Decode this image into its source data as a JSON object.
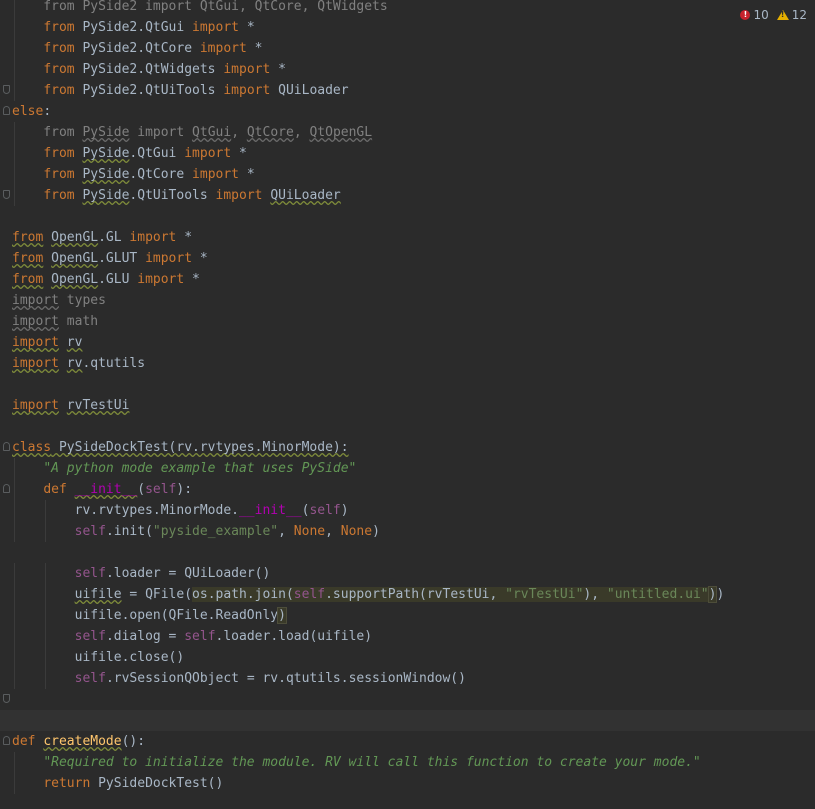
{
  "inspection": {
    "errors": "10",
    "warnings": "12"
  },
  "colors": {
    "background": "#2b2b2b",
    "keyword": "#cc7832",
    "string": "#6a8759",
    "self": "#94558d",
    "function_name": "#ffc66d",
    "error": "#c7222d",
    "warning": "#e6b000"
  },
  "code_lines": [
    [
      {
        "t": "    from PySide2 import QtGui, QtCore, QtWidgets",
        "c": "gray"
      }
    ],
    [
      {
        "t": "    "
      },
      {
        "t": "from",
        "c": "kw"
      },
      {
        "t": " PySide2.QtGui "
      },
      {
        "t": "import",
        "c": "kw"
      },
      {
        "t": " *"
      }
    ],
    [
      {
        "t": "    "
      },
      {
        "t": "from",
        "c": "kw"
      },
      {
        "t": " PySide2.QtCore "
      },
      {
        "t": "import",
        "c": "kw"
      },
      {
        "t": " *"
      }
    ],
    [
      {
        "t": "    "
      },
      {
        "t": "from",
        "c": "kw"
      },
      {
        "t": " PySide2.QtWidgets "
      },
      {
        "t": "import",
        "c": "kw"
      },
      {
        "t": " *"
      }
    ],
    [
      {
        "t": "    "
      },
      {
        "t": "from",
        "c": "kw"
      },
      {
        "t": " PySide2.QtUiTools "
      },
      {
        "t": "import",
        "c": "kw"
      },
      {
        "t": " QUiLoader"
      }
    ],
    [
      {
        "t": "else",
        "c": "kw"
      },
      {
        "t": ":"
      }
    ],
    [
      {
        "t": "    from ",
        "c": "gray"
      },
      {
        "t": "PySide",
        "c": "gray ulg"
      },
      {
        "t": " import ",
        "c": "gray"
      },
      {
        "t": "QtGui",
        "c": "gray ulg"
      },
      {
        "t": ", ",
        "c": "gray"
      },
      {
        "t": "QtCore",
        "c": "gray ulg"
      },
      {
        "t": ", ",
        "c": "gray"
      },
      {
        "t": "QtOpenGL",
        "c": "gray ulg"
      }
    ],
    [
      {
        "t": "    "
      },
      {
        "t": "from",
        "c": "kw"
      },
      {
        "t": " "
      },
      {
        "t": "PySide",
        "c": "ul"
      },
      {
        "t": ".QtGui "
      },
      {
        "t": "import",
        "c": "kw"
      },
      {
        "t": " *"
      }
    ],
    [
      {
        "t": "    "
      },
      {
        "t": "from",
        "c": "kw"
      },
      {
        "t": " "
      },
      {
        "t": "PySide",
        "c": "ul"
      },
      {
        "t": ".QtCore "
      },
      {
        "t": "import",
        "c": "kw"
      },
      {
        "t": " *"
      }
    ],
    [
      {
        "t": "    "
      },
      {
        "t": "from",
        "c": "kw"
      },
      {
        "t": " "
      },
      {
        "t": "PySide",
        "c": "ul"
      },
      {
        "t": ".QtUiTools "
      },
      {
        "t": "import",
        "c": "kw"
      },
      {
        "t": " "
      },
      {
        "t": "QUiLoader",
        "c": "ul"
      }
    ],
    [],
    [
      {
        "t": "from",
        "c": "kw ul"
      },
      {
        "t": " "
      },
      {
        "t": "OpenGL",
        "c": "ul"
      },
      {
        "t": ".GL "
      },
      {
        "t": "import",
        "c": "kw"
      },
      {
        "t": " *"
      }
    ],
    [
      {
        "t": "from",
        "c": "kw ul"
      },
      {
        "t": " "
      },
      {
        "t": "OpenGL",
        "c": "ul"
      },
      {
        "t": ".GLUT "
      },
      {
        "t": "import",
        "c": "kw"
      },
      {
        "t": " *"
      }
    ],
    [
      {
        "t": "from",
        "c": "kw ul"
      },
      {
        "t": " "
      },
      {
        "t": "OpenGL",
        "c": "ul"
      },
      {
        "t": ".GLU "
      },
      {
        "t": "import",
        "c": "kw"
      },
      {
        "t": " *"
      }
    ],
    [
      {
        "t": "import",
        "c": "gray ulg"
      },
      {
        "t": " types",
        "c": "gray"
      }
    ],
    [
      {
        "t": "import",
        "c": "gray ulg"
      },
      {
        "t": " math",
        "c": "gray"
      }
    ],
    [
      {
        "t": "import",
        "c": "kw ul"
      },
      {
        "t": " "
      },
      {
        "t": "rv",
        "c": "ul"
      }
    ],
    [
      {
        "t": "import",
        "c": "kw ul"
      },
      {
        "t": " "
      },
      {
        "t": "rv",
        "c": "ul"
      },
      {
        "t": ".qtutils"
      }
    ],
    [],
    [
      {
        "t": "import",
        "c": "kw ul"
      },
      {
        "t": " "
      },
      {
        "t": "rvTestUi",
        "c": "ul"
      }
    ],
    [],
    [
      {
        "t": "class",
        "c": "kw ul"
      },
      {
        "t": " PySideDockTest(rv.rvtypes.MinorMode):",
        "c": "ul"
      }
    ],
    [
      {
        "t": "    "
      },
      {
        "t": "\"A python mode example that uses PySide\"",
        "c": "doc"
      }
    ],
    [
      {
        "t": "    "
      },
      {
        "t": "def",
        "c": "kw"
      },
      {
        "t": " "
      },
      {
        "t": "__init__",
        "c": "magic ul"
      },
      {
        "t": "("
      },
      {
        "t": "self",
        "c": "self"
      },
      {
        "t": "):"
      }
    ],
    [
      {
        "t": "        rv.rvtypes.MinorMode."
      },
      {
        "t": "__init__",
        "c": "magic"
      },
      {
        "t": "("
      },
      {
        "t": "self",
        "c": "self"
      },
      {
        "t": ")"
      }
    ],
    [
      {
        "t": "        "
      },
      {
        "t": "self",
        "c": "self"
      },
      {
        "t": ".init("
      },
      {
        "t": "\"pyside_example\"",
        "c": "str"
      },
      {
        "t": ", "
      },
      {
        "t": "None",
        "c": "kw"
      },
      {
        "t": ", "
      },
      {
        "t": "None",
        "c": "kw"
      },
      {
        "t": ")"
      }
    ],
    [],
    [
      {
        "t": "        "
      },
      {
        "t": "self",
        "c": "self"
      },
      {
        "t": ".loader = QUiLoader()"
      }
    ],
    [
      {
        "t": "        "
      },
      {
        "t": "uifile",
        "c": "ul"
      },
      {
        "t": " = QFile("
      },
      {
        "t": "os.path.join(",
        "c": "hl"
      },
      {
        "t": "self",
        "c": "self hl"
      },
      {
        "t": ".supportPath(rvTestUi, ",
        "c": "hl"
      },
      {
        "t": "\"rvTestUi\"",
        "c": "str hl"
      },
      {
        "t": "), ",
        "c": "hl"
      },
      {
        "t": "\"untitled.ui\"",
        "c": "str hl"
      },
      {
        "t": ")",
        "c": "hlb"
      },
      {
        "t": ")"
      }
    ],
    [
      {
        "t": "        uifile.open(QFile.ReadOnly"
      },
      {
        "t": ")",
        "c": "hlb"
      }
    ],
    [
      {
        "t": "        "
      },
      {
        "t": "self",
        "c": "self"
      },
      {
        "t": ".dialog = "
      },
      {
        "t": "self",
        "c": "self"
      },
      {
        "t": ".loader.load(uifile)"
      }
    ],
    [
      {
        "t": "        uifile.close()"
      }
    ],
    [
      {
        "t": "        "
      },
      {
        "t": "self",
        "c": "self"
      },
      {
        "t": ".rvSessionQObject = rv.qtutils.sessionWindow()"
      }
    ],
    [],
    [],
    [
      {
        "t": "def",
        "c": "kw"
      },
      {
        "t": " "
      },
      {
        "t": "createMode",
        "c": "fn ul"
      },
      {
        "t": "():"
      }
    ],
    [
      {
        "t": "    "
      },
      {
        "t": "\"Required to initialize the module. RV will call this function to create your mode.\"",
        "c": "doc"
      }
    ],
    [
      {
        "t": "    "
      },
      {
        "t": "return",
        "c": "kw"
      },
      {
        "t": " PySideDockTest()"
      }
    ]
  ]
}
